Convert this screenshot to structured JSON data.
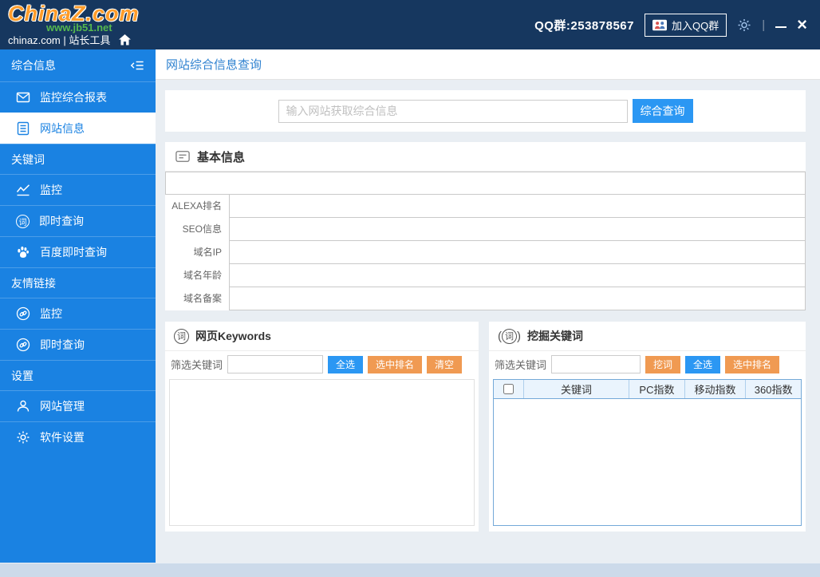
{
  "titlebar": {
    "logo_text": "ChinaZ.com",
    "watermark": "www.jb51.net",
    "site_label": "chinaz.com | 站长工具",
    "qq_group_label": "QQ群:253878567",
    "join_qq_label": "加入QQ群"
  },
  "sidebar": {
    "items": [
      {
        "type": "header",
        "label": "综合信息",
        "icon": "collapse-sidebar-icon"
      },
      {
        "type": "item",
        "label": "监控综合报表",
        "icon": "envelope-icon",
        "active": false
      },
      {
        "type": "item",
        "label": "网站信息",
        "icon": "document-icon",
        "active": true
      },
      {
        "type": "section",
        "label": "关键词"
      },
      {
        "type": "item",
        "label": "监控",
        "icon": "chart-icon",
        "active": false
      },
      {
        "type": "item",
        "label": "即时查询",
        "icon": "word-circle-icon",
        "active": false
      },
      {
        "type": "item",
        "label": "百度即时查询",
        "icon": "baidu-paw-icon",
        "active": false
      },
      {
        "type": "section",
        "label": "友情链接"
      },
      {
        "type": "item",
        "label": "监控",
        "icon": "link-icon",
        "active": false
      },
      {
        "type": "item",
        "label": "即时查询",
        "icon": "link-icon",
        "active": false
      },
      {
        "type": "section",
        "label": "设置"
      },
      {
        "type": "item",
        "label": "网站管理",
        "icon": "user-icon",
        "active": false
      },
      {
        "type": "item",
        "label": "软件设置",
        "icon": "gear-icon",
        "active": false
      }
    ]
  },
  "main": {
    "page_title": "网站综合信息查询",
    "search": {
      "placeholder": "输入网站获取综合信息",
      "button_label": "综合查询"
    },
    "basic_info": {
      "title": "基本信息",
      "rows": [
        "ALEXA排名",
        "SEO信息",
        "域名IP",
        "域名年龄",
        "域名备案"
      ]
    },
    "keywords_panel": {
      "title": "网页Keywords",
      "icon": "word-circle-icon",
      "filter_label": "筛选关键词",
      "filter_value": "",
      "buttons": [
        {
          "label": "全选",
          "color": "blue"
        },
        {
          "label": "选中排名",
          "color": "orange"
        },
        {
          "label": "清空",
          "color": "orange"
        }
      ]
    },
    "mining_panel": {
      "title": "挖掘关键词",
      "icon": "broadcast-word-icon",
      "filter_label": "筛选关键词",
      "filter_value": "",
      "buttons": [
        {
          "label": "挖词",
          "color": "orange"
        },
        {
          "label": "全选",
          "color": "blue"
        },
        {
          "label": "选中排名",
          "color": "orange"
        }
      ],
      "table_headers": [
        "关键词",
        "PC指数",
        "移动指数",
        "360指数"
      ],
      "table_rows": []
    }
  },
  "colors": {
    "titlebar_bg": "#16375f",
    "sidebar_bg": "#1a82e2",
    "accent_blue": "#2b97f3",
    "accent_orange": "#f09a52",
    "page_title_text": "#2f82d0",
    "watermark_green": "#55b84f",
    "table_border_blue": "#74a9d8"
  }
}
